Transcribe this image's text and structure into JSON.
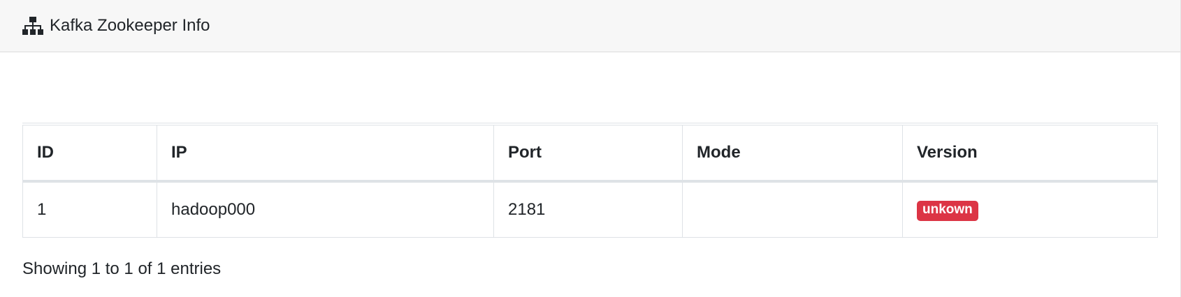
{
  "header": {
    "title": "Kafka Zookeeper Info",
    "icon": "sitemap-icon"
  },
  "table": {
    "columns": [
      "ID",
      "IP",
      "Port",
      "Mode",
      "Version"
    ],
    "rows": [
      {
        "id": "1",
        "ip": "hadoop000",
        "port": "2181",
        "mode": "",
        "version": "unkown"
      }
    ]
  },
  "footer": {
    "info": "Showing 1 to 1 of 1 entries"
  },
  "colors": {
    "header_bg": "#f7f7f7",
    "badge_danger": "#dc3545",
    "border": "#dee2e6",
    "text": "#212529"
  }
}
